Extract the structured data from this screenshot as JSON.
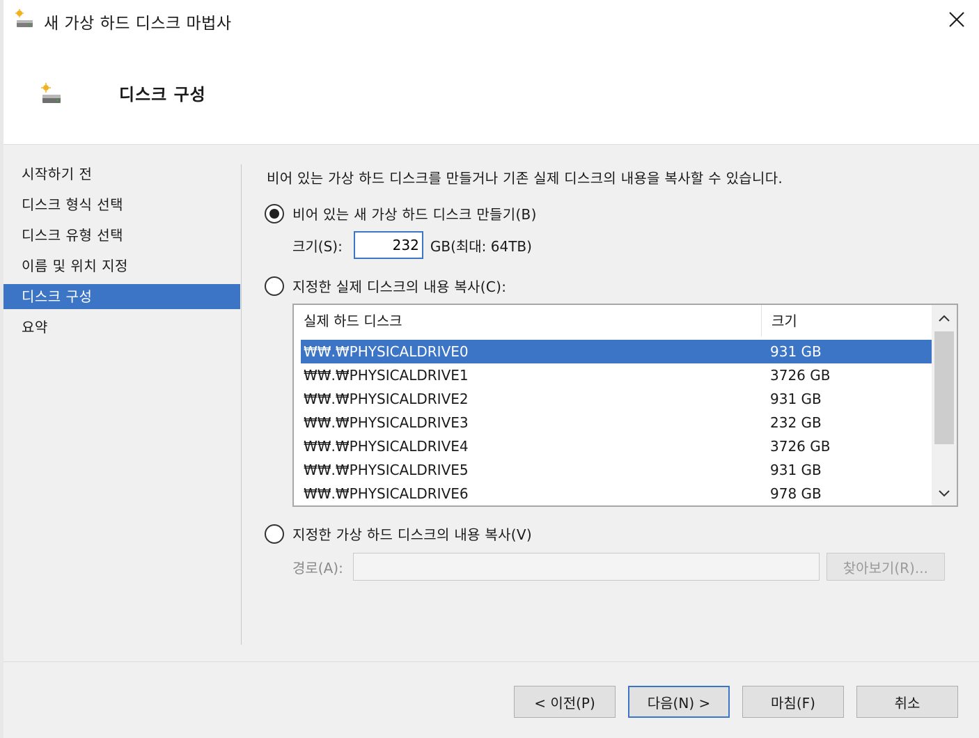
{
  "window": {
    "title": "새 가상 하드 디스크 마법사",
    "title_icon": "virtual-disk-icon",
    "close_icon": "close-icon"
  },
  "header": {
    "title": "디스크 구성",
    "icon": "virtual-disk-icon"
  },
  "sidebar": {
    "items": [
      {
        "label": "시작하기 전",
        "active": false
      },
      {
        "label": "디스크 형식 선택",
        "active": false
      },
      {
        "label": "디스크 유형 선택",
        "active": false
      },
      {
        "label": "이름 및 위치 지정",
        "active": false
      },
      {
        "label": "디스크 구성",
        "active": true
      },
      {
        "label": "요약",
        "active": false
      }
    ]
  },
  "content": {
    "intro": "비어 있는 가상 하드 디스크를 만들거나 기존 실제 디스크의 내용을 복사할 수 있습니다.",
    "option_new": {
      "label": "비어 있는 새 가상 하드 디스크 만들기(B)",
      "selected": true
    },
    "size": {
      "label": "크기(S):",
      "value": "232",
      "unit": "GB(최대: 64TB)"
    },
    "option_physical": {
      "label": "지정한 실제 디스크의 내용 복사(C):",
      "selected": false
    },
    "disk_table": {
      "headers": {
        "name": "실제 하드 디스크",
        "size": "크기"
      },
      "rows": [
        {
          "name": "₩₩.₩PHYSICALDRIVE0",
          "size": "931 GB",
          "selected": true
        },
        {
          "name": "₩₩.₩PHYSICALDRIVE1",
          "size": "3726 GB",
          "selected": false
        },
        {
          "name": "₩₩.₩PHYSICALDRIVE2",
          "size": "931 GB",
          "selected": false
        },
        {
          "name": "₩₩.₩PHYSICALDRIVE3",
          "size": "232 GB",
          "selected": false
        },
        {
          "name": "₩₩.₩PHYSICALDRIVE4",
          "size": "3726 GB",
          "selected": false
        },
        {
          "name": "₩₩.₩PHYSICALDRIVE5",
          "size": "931 GB",
          "selected": false
        },
        {
          "name": "₩₩.₩PHYSICALDRIVE6",
          "size": "978 GB",
          "selected": false
        }
      ]
    },
    "option_virtual": {
      "label": "지정한 가상 하드 디스크의 내용 복사(V)",
      "selected": false
    },
    "path": {
      "label": "경로(A):",
      "value": "",
      "browse_label": "찾아보기(R)..."
    }
  },
  "footer": {
    "prev_label": "< 이전(P)",
    "next_label": "다음(N) >",
    "finish_label": "마침(F)",
    "cancel_label": "취소"
  },
  "colors": {
    "accent": "#3c74c6",
    "background": "#f0f0f0",
    "header_background": "#ffffff"
  }
}
